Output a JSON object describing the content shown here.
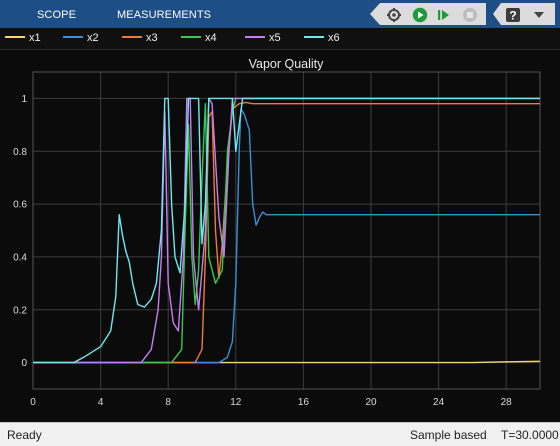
{
  "toolstrip": {
    "tabs": [
      {
        "label": "SCOPE"
      },
      {
        "label": "MEASUREMENTS"
      }
    ],
    "buttons": [
      "settings-run-icon",
      "run-icon",
      "step-forward-icon",
      "stop-icon",
      "help-icon",
      "dock-icon"
    ]
  },
  "legend": {
    "items": [
      {
        "label": "x1",
        "color": "#f5d76e"
      },
      {
        "label": "x2",
        "color": "#3a8fd8"
      },
      {
        "label": "x3",
        "color": "#ee7b3c"
      },
      {
        "label": "x4",
        "color": "#39c84a"
      },
      {
        "label": "x5",
        "color": "#c77df0"
      },
      {
        "label": "x6",
        "color": "#6fe9f0"
      }
    ]
  },
  "chart_data": {
    "type": "line",
    "title": "Vapor Quality",
    "xlabel": "",
    "ylabel": "",
    "xlim": [
      0,
      30
    ],
    "ylim": [
      -0.1,
      1.1
    ],
    "xticks": [
      0,
      4,
      8,
      12,
      16,
      20,
      24,
      28
    ],
    "yticks": [
      0,
      0.2,
      0.4,
      0.6,
      0.8,
      1
    ],
    "grid": true,
    "series": [
      {
        "name": "x1",
        "color": "#f5d76e",
        "points": [
          [
            0,
            0
          ],
          [
            12,
            0
          ],
          [
            20,
            0
          ],
          [
            26,
            0
          ],
          [
            28,
            0.003
          ],
          [
            30,
            0.005
          ]
        ]
      },
      {
        "name": "x2",
        "color": "#3a8fd8",
        "points": [
          [
            0,
            0
          ],
          [
            11,
            0
          ],
          [
            11.5,
            0.02
          ],
          [
            11.8,
            0.08
          ],
          [
            12.0,
            0.3
          ],
          [
            12.2,
            0.8
          ],
          [
            12.3,
            0.96
          ],
          [
            12.5,
            0.94
          ],
          [
            12.8,
            0.88
          ],
          [
            13.0,
            0.6
          ],
          [
            13.2,
            0.52
          ],
          [
            13.4,
            0.55
          ],
          [
            13.6,
            0.57
          ],
          [
            13.8,
            0.56
          ],
          [
            14.5,
            0.56
          ],
          [
            20,
            0.56
          ],
          [
            30,
            0.56
          ]
        ]
      },
      {
        "name": "x3",
        "color": "#ee7b3c",
        "points": [
          [
            0,
            0
          ],
          [
            9.6,
            0
          ],
          [
            10.0,
            0.05
          ],
          [
            10.2,
            0.4
          ],
          [
            10.4,
            0.93
          ],
          [
            10.6,
            0.95
          ],
          [
            10.8,
            0.5
          ],
          [
            11.0,
            0.32
          ],
          [
            11.2,
            0.45
          ],
          [
            11.5,
            0.75
          ],
          [
            11.8,
            0.96
          ],
          [
            12.2,
            0.98
          ],
          [
            12.6,
            0.985
          ],
          [
            13,
            0.98
          ],
          [
            30,
            0.98
          ]
        ]
      },
      {
        "name": "x4",
        "color": "#39c84a",
        "points": [
          [
            0,
            0
          ],
          [
            8.2,
            0
          ],
          [
            8.8,
            0.05
          ],
          [
            9.0,
            0.5
          ],
          [
            9.2,
            0.9
          ],
          [
            9.4,
            0.4
          ],
          [
            9.6,
            0.22
          ],
          [
            9.8,
            0.35
          ],
          [
            10.0,
            0.7
          ],
          [
            10.2,
            0.98
          ],
          [
            10.4,
            0.4
          ],
          [
            10.8,
            0.3
          ],
          [
            11.2,
            0.35
          ],
          [
            11.5,
            0.8
          ],
          [
            11.8,
            0.95
          ],
          [
            12.0,
            1
          ],
          [
            30,
            1
          ]
        ]
      },
      {
        "name": "x5",
        "color": "#c77df0",
        "points": [
          [
            0,
            0
          ],
          [
            6.4,
            0
          ],
          [
            7.0,
            0.05
          ],
          [
            7.4,
            0.2
          ],
          [
            7.6,
            0.4
          ],
          [
            7.8,
            0.95
          ],
          [
            8.0,
            0.3
          ],
          [
            8.3,
            0.15
          ],
          [
            8.6,
            0.12
          ],
          [
            8.9,
            0.4
          ],
          [
            9.1,
            1
          ],
          [
            9.3,
            1
          ],
          [
            9.5,
            0.4
          ],
          [
            9.8,
            0.2
          ],
          [
            10.2,
            0.5
          ],
          [
            10.4,
            1
          ],
          [
            10.6,
            0.98
          ],
          [
            11.0,
            0.55
          ],
          [
            11.3,
            0.4
          ],
          [
            11.6,
            0.8
          ],
          [
            11.8,
            1
          ],
          [
            30,
            1
          ]
        ]
      },
      {
        "name": "x6",
        "color": "#6fe9f0",
        "points": [
          [
            0,
            0
          ],
          [
            2.4,
            0
          ],
          [
            3,
            0.02
          ],
          [
            4,
            0.06
          ],
          [
            4.6,
            0.12
          ],
          [
            4.9,
            0.25
          ],
          [
            5.1,
            0.56
          ],
          [
            5.3,
            0.48
          ],
          [
            5.5,
            0.42
          ],
          [
            5.7,
            0.38
          ],
          [
            5.9,
            0.3
          ],
          [
            6.2,
            0.22
          ],
          [
            6.6,
            0.21
          ],
          [
            7.0,
            0.24
          ],
          [
            7.3,
            0.3
          ],
          [
            7.6,
            0.5
          ],
          [
            7.8,
            1
          ],
          [
            8.0,
            1
          ],
          [
            8.2,
            0.6
          ],
          [
            8.4,
            0.4
          ],
          [
            8.7,
            0.34
          ],
          [
            9.0,
            0.6
          ],
          [
            9.2,
            1
          ],
          [
            9.8,
            1
          ],
          [
            10.0,
            0.45
          ],
          [
            10.2,
            0.6
          ],
          [
            10.4,
            1
          ],
          [
            11.8,
            1
          ],
          [
            12.0,
            0.8
          ],
          [
            12.2,
            0.9
          ],
          [
            12.4,
            1
          ],
          [
            30,
            1
          ]
        ]
      }
    ]
  },
  "status": {
    "left": "Ready",
    "mode": "Sample based",
    "time": "T=30.0000"
  }
}
